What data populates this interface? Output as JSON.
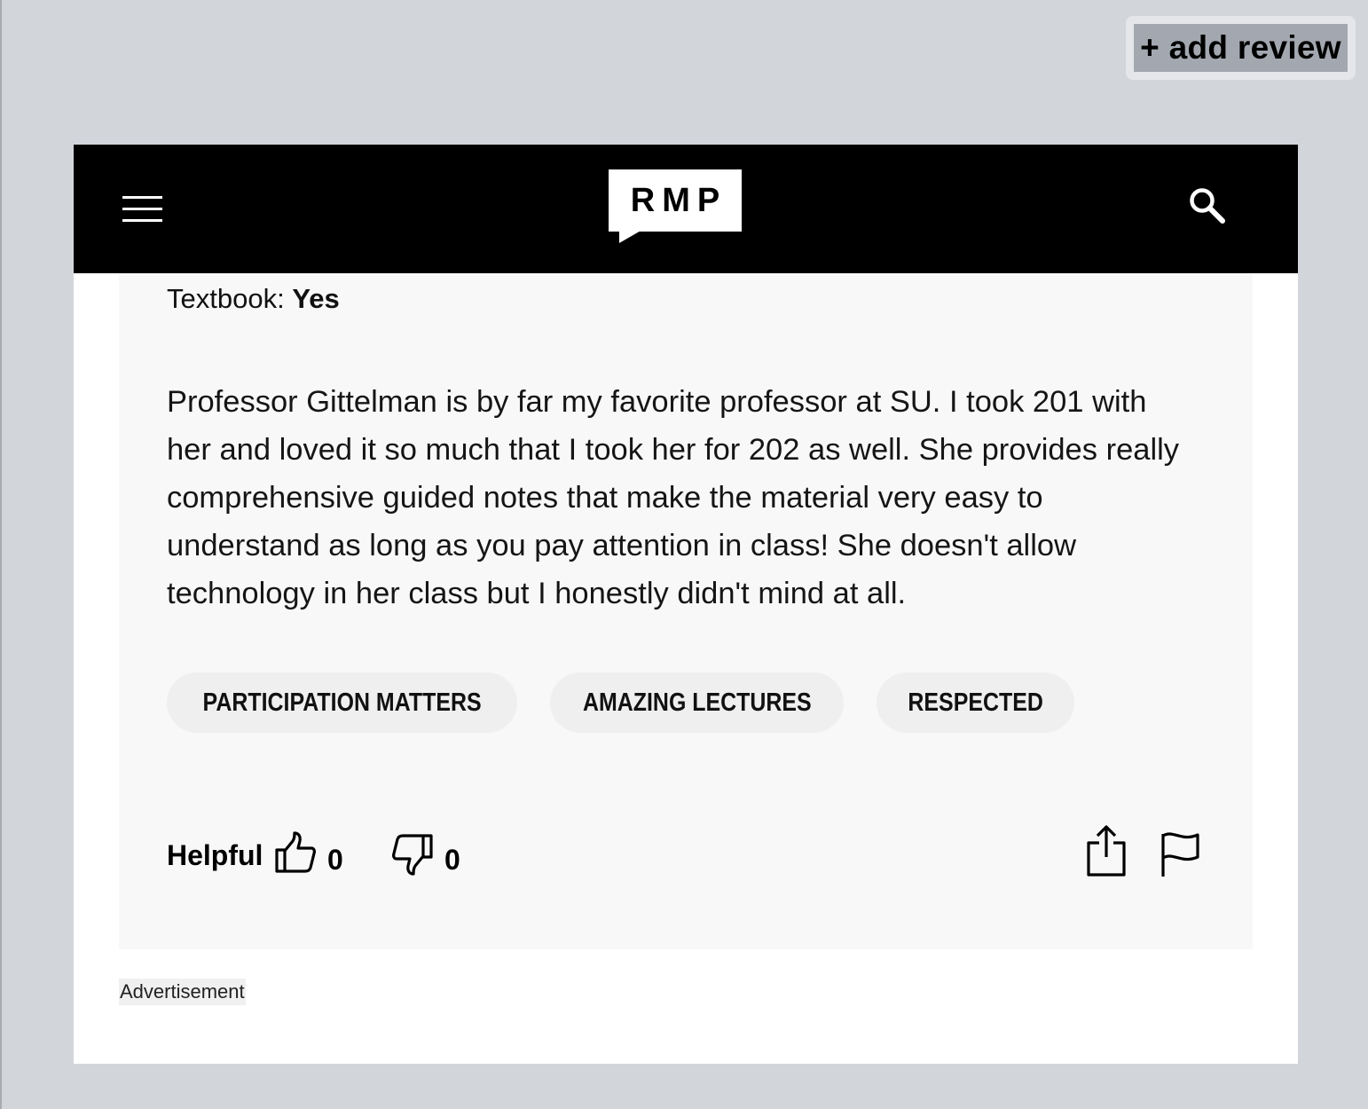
{
  "add_review": {
    "label": "+ add review"
  },
  "header": {
    "logo_text": "RMP",
    "menu_icon": "hamburger-menu-icon",
    "search_icon": "search-icon"
  },
  "review": {
    "textbook_label": "Textbook:",
    "textbook_value": "Yes",
    "comment": "Professor Gittelman is by far my favorite professor at SU. I took 201 with her and loved it so much that I took her for 202 as well. She provides really comprehensive guided notes that make the material very easy to understand as long as you pay attention in class! She doesn't allow technology in her class but I honestly didn't mind at all.",
    "tags": [
      "PARTICIPATION MATTERS",
      "AMAZING LECTURES",
      "RESPECTED"
    ],
    "helpful_label": "Helpful",
    "thumbs_up_count": "0",
    "thumbs_down_count": "0",
    "share_icon": "share-icon",
    "flag_icon": "flag-icon"
  },
  "advertisement_label": "Advertisement",
  "colors": {
    "background": "#d2d5da",
    "header": "#000000",
    "card": "#f8f8f8",
    "tag": "#efefef",
    "add_review_button": "#a3a8b0"
  }
}
